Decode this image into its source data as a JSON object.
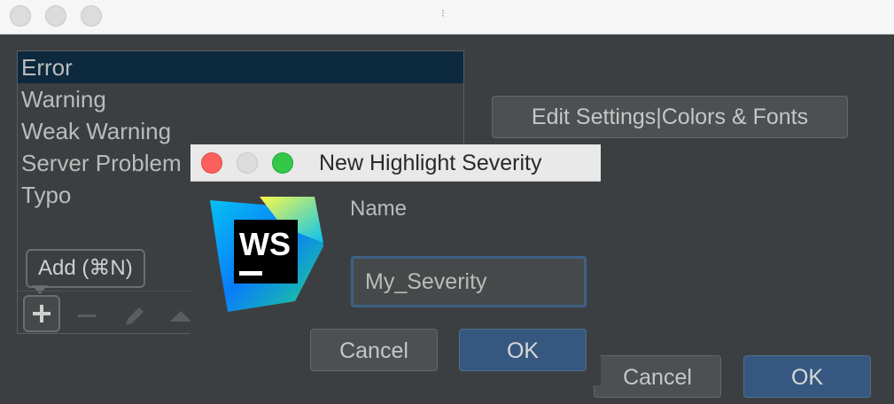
{
  "outer_window": {
    "title_mark": "⁝"
  },
  "severity_list": {
    "items": [
      {
        "label": "Error",
        "selected": true
      },
      {
        "label": "Warning",
        "selected": false
      },
      {
        "label": "Weak Warning",
        "selected": false
      },
      {
        "label": "Server Problem",
        "selected": false
      },
      {
        "label": "Typo",
        "selected": false
      }
    ]
  },
  "toolbar": {
    "add_tooltip": "Add (⌘N)",
    "add_icon": "plus-icon",
    "remove_icon": "minus-icon",
    "edit_icon": "pencil-icon",
    "move_up_icon": "arrow-up-icon"
  },
  "buttons": {
    "edit_settings": "Edit Settings|Colors & Fonts",
    "cancel": "Cancel",
    "ok": "OK"
  },
  "dialog": {
    "title": "New Highlight Severity",
    "logo_text": "WS",
    "name_label": "Name",
    "name_value": "My_Severity",
    "cancel": "Cancel",
    "ok": "OK"
  },
  "colors": {
    "background": "#3c3f41",
    "selection": "#0d293e",
    "primary_button": "#365880",
    "input_focus_border": "#3d6185"
  }
}
